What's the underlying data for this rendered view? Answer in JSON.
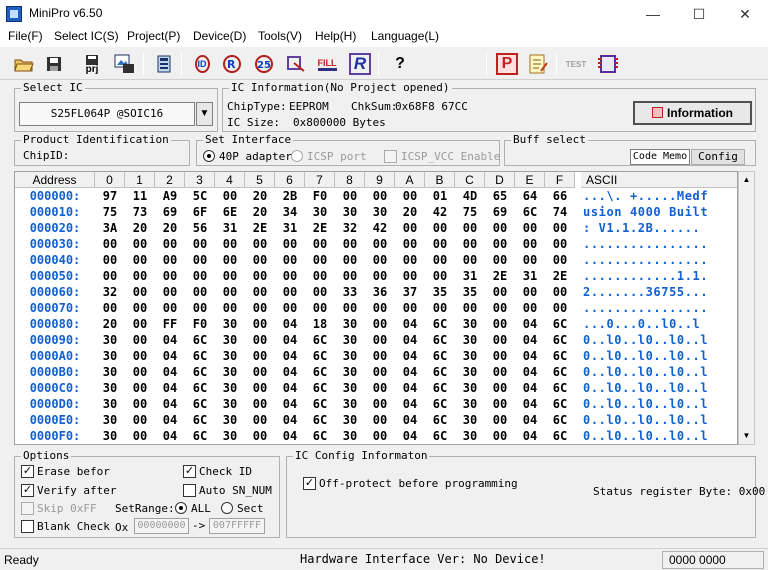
{
  "window": {
    "title": "MiniPro v6.50",
    "minimize": "—",
    "maximize": "☐",
    "close": "✕"
  },
  "menu": [
    "File(F)",
    "Select IC(S)",
    "Project(P)",
    "Device(D)",
    "Tools(V)",
    "Help(H)",
    "Language(L)"
  ],
  "toolbar": {
    "prj_label": "prj",
    "id_label": "ID",
    "fill_label": "FILL",
    "r_label": "R",
    "p_label": "P",
    "test_label": "TEST",
    "help_glyph": "?"
  },
  "select_ic": {
    "title": "Select IC",
    "value": "S25FL064P @SOIC16"
  },
  "ic_info": {
    "title": "IC Information(No Project opened)",
    "chip_type_label": "ChipType:",
    "chip_type": "EEPROM",
    "chksum_label": "ChkSum:",
    "chksum": "0x68F8 67CC",
    "ic_size_label": "IC Size:",
    "ic_size": "0x800000 Bytes",
    "info_button": "Information"
  },
  "product_id": {
    "title": "Product Identification",
    "chip_id_label": "ChipID:"
  },
  "set_interface": {
    "title": "Set Interface",
    "opt1": "40P adapter",
    "opt2": "ICSP port",
    "opt3": "ICSP_VCC Enable"
  },
  "buff_select": {
    "title": "Buff select",
    "code_memo": "Code Memo",
    "config": "Config"
  },
  "hex": {
    "address_header": "Address",
    "columns": [
      "0",
      "1",
      "2",
      "3",
      "4",
      "5",
      "6",
      "7",
      "8",
      "9",
      "A",
      "B",
      "C",
      "D",
      "E",
      "F"
    ],
    "ascii_header": "ASCII",
    "rows": [
      {
        "addr": "000000:",
        "bytes": [
          "97",
          "11",
          "A9",
          "5C",
          "00",
          "20",
          "2B",
          "F0",
          "00",
          "00",
          "00",
          "01",
          "4D",
          "65",
          "64",
          "66"
        ],
        "ascii": "...\\. +.....Medf"
      },
      {
        "addr": "000010:",
        "bytes": [
          "75",
          "73",
          "69",
          "6F",
          "6E",
          "20",
          "34",
          "30",
          "30",
          "30",
          "20",
          "42",
          "75",
          "69",
          "6C",
          "74"
        ],
        "ascii": "usion 4000 Built"
      },
      {
        "addr": "000020:",
        "bytes": [
          "3A",
          "20",
          "20",
          "56",
          "31",
          "2E",
          "31",
          "2E",
          "32",
          "42",
          "00",
          "00",
          "00",
          "00",
          "00",
          "00"
        ],
        "ascii": ":  V1.1.2B......"
      },
      {
        "addr": "000030:",
        "bytes": [
          "00",
          "00",
          "00",
          "00",
          "00",
          "00",
          "00",
          "00",
          "00",
          "00",
          "00",
          "00",
          "00",
          "00",
          "00",
          "00"
        ],
        "ascii": "................"
      },
      {
        "addr": "000040:",
        "bytes": [
          "00",
          "00",
          "00",
          "00",
          "00",
          "00",
          "00",
          "00",
          "00",
          "00",
          "00",
          "00",
          "00",
          "00",
          "00",
          "00"
        ],
        "ascii": "................"
      },
      {
        "addr": "000050:",
        "bytes": [
          "00",
          "00",
          "00",
          "00",
          "00",
          "00",
          "00",
          "00",
          "00",
          "00",
          "00",
          "00",
          "31",
          "2E",
          "31",
          "2E"
        ],
        "ascii": "............1.1."
      },
      {
        "addr": "000060:",
        "bytes": [
          "32",
          "00",
          "00",
          "00",
          "00",
          "00",
          "00",
          "00",
          "33",
          "36",
          "37",
          "35",
          "35",
          "00",
          "00",
          "00"
        ],
        "ascii": "2.......36755..."
      },
      {
        "addr": "000070:",
        "bytes": [
          "00",
          "00",
          "00",
          "00",
          "00",
          "00",
          "00",
          "00",
          "00",
          "00",
          "00",
          "00",
          "00",
          "00",
          "00",
          "00"
        ],
        "ascii": "................"
      },
      {
        "addr": "000080:",
        "bytes": [
          "20",
          "00",
          "FF",
          "F0",
          "30",
          "00",
          "04",
          "18",
          "30",
          "00",
          "04",
          "6C",
          "30",
          "00",
          "04",
          "6C"
        ],
        "ascii": " ...0...0..l0..l"
      },
      {
        "addr": "000090:",
        "bytes": [
          "30",
          "00",
          "04",
          "6C",
          "30",
          "00",
          "04",
          "6C",
          "30",
          "00",
          "04",
          "6C",
          "30",
          "00",
          "04",
          "6C"
        ],
        "ascii": "0..l0..l0..l0..l"
      },
      {
        "addr": "0000A0:",
        "bytes": [
          "30",
          "00",
          "04",
          "6C",
          "30",
          "00",
          "04",
          "6C",
          "30",
          "00",
          "04",
          "6C",
          "30",
          "00",
          "04",
          "6C"
        ],
        "ascii": "0..l0..l0..l0..l"
      },
      {
        "addr": "0000B0:",
        "bytes": [
          "30",
          "00",
          "04",
          "6C",
          "30",
          "00",
          "04",
          "6C",
          "30",
          "00",
          "04",
          "6C",
          "30",
          "00",
          "04",
          "6C"
        ],
        "ascii": "0..l0..l0..l0..l"
      },
      {
        "addr": "0000C0:",
        "bytes": [
          "30",
          "00",
          "04",
          "6C",
          "30",
          "00",
          "04",
          "6C",
          "30",
          "00",
          "04",
          "6C",
          "30",
          "00",
          "04",
          "6C"
        ],
        "ascii": "0..l0..l0..l0..l"
      },
      {
        "addr": "0000D0:",
        "bytes": [
          "30",
          "00",
          "04",
          "6C",
          "30",
          "00",
          "04",
          "6C",
          "30",
          "00",
          "04",
          "6C",
          "30",
          "00",
          "04",
          "6C"
        ],
        "ascii": "0..l0..l0..l0..l"
      },
      {
        "addr": "0000E0:",
        "bytes": [
          "30",
          "00",
          "04",
          "6C",
          "30",
          "00",
          "04",
          "6C",
          "30",
          "00",
          "04",
          "6C",
          "30",
          "00",
          "04",
          "6C"
        ],
        "ascii": "0..l0..l0..l0..l"
      },
      {
        "addr": "0000F0:",
        "bytes": [
          "30",
          "00",
          "04",
          "6C",
          "30",
          "00",
          "04",
          "6C",
          "30",
          "00",
          "04",
          "6C",
          "30",
          "00",
          "04",
          "6C"
        ],
        "ascii": "0..l0..l0..l0..l"
      }
    ]
  },
  "options": {
    "title": "Options",
    "erase_before": "Erase befor",
    "verify_after": "Verify after",
    "skip_0xff": "Skip 0xFF",
    "blank_check": "Blank Check",
    "check_id": "Check ID",
    "auto_sn_num": "Auto SN_NUM",
    "set_range_label": "SetRange:",
    "range_all": "ALL",
    "range_sect": "Sect",
    "ox_label": "Ox",
    "range_start": "00000000",
    "range_arrow": "->",
    "range_end": "007FFFFF"
  },
  "ic_config": {
    "title": "IC Config Informaton",
    "off_protect": "Off-protect before programming",
    "status_register": "Status register Byte: 0x00"
  },
  "status": {
    "left": "Ready",
    "center": "Hardware Interface Ver: No Device!",
    "right": "0000 0000"
  }
}
